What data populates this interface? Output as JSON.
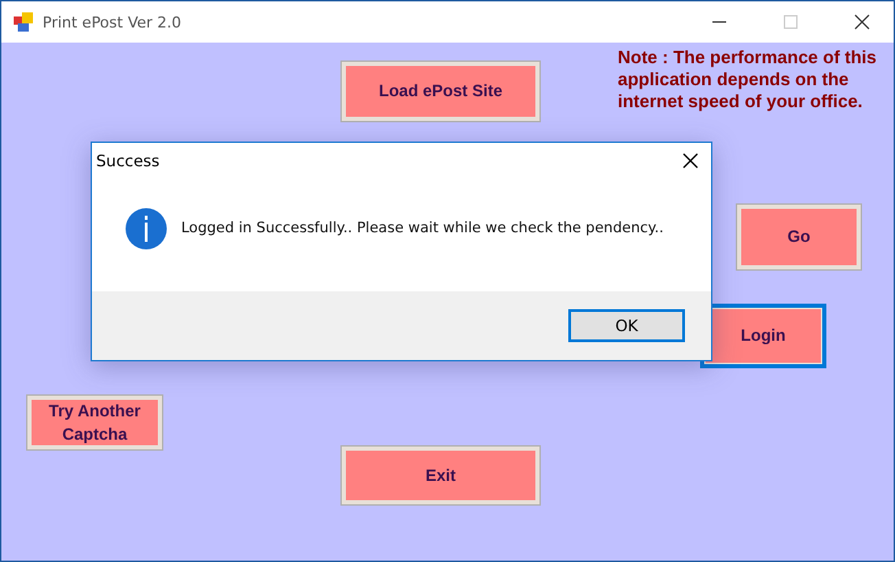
{
  "window": {
    "title": "Print ePost Ver 2.0"
  },
  "note": "Note : The performance of this application depends on the internet speed of your office.",
  "buttons": [
    {
      "label": "Load ePost Site",
      "focused": false
    },
    {
      "label": "Go",
      "focused": false
    },
    {
      "label": "Login",
      "focused": true
    },
    {
      "label": "Try Another Captcha",
      "focused": false
    },
    {
      "label": "Exit",
      "focused": false
    }
  ],
  "dialog": {
    "title": "Success",
    "message": "Logged in Successfully.. Please wait while we check the pendency..",
    "button": "OK"
  }
}
